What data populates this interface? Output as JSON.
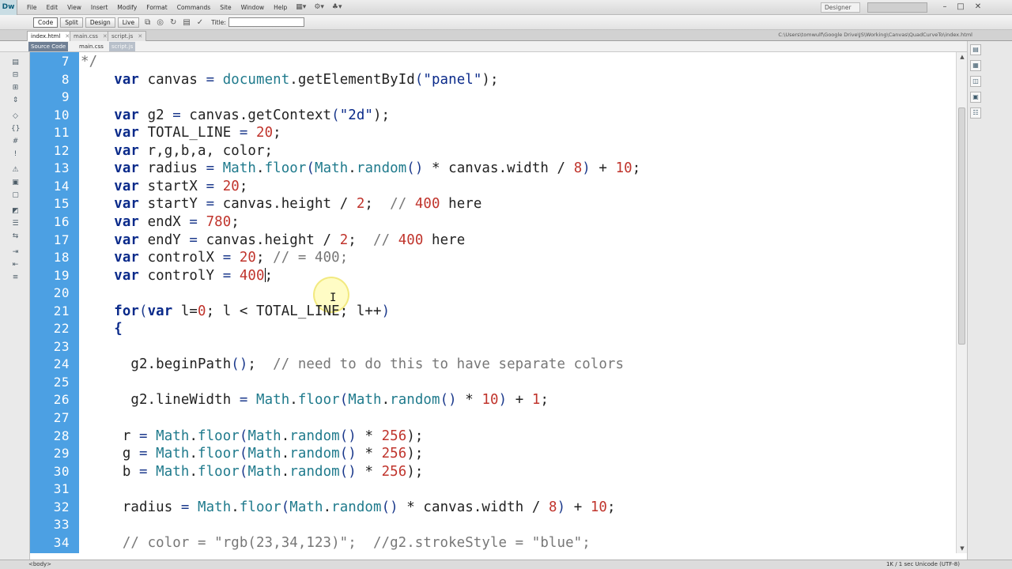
{
  "app": {
    "logo": "Dw"
  },
  "menu": [
    "File",
    "Edit",
    "View",
    "Insert",
    "Modify",
    "Format",
    "Commands",
    "Site",
    "Window",
    "Help"
  ],
  "workspace": "Designer",
  "toolbar": {
    "code": "Code",
    "split": "Split",
    "design": "Design",
    "live": "Live",
    "title_label": "Title:",
    "title_value": ""
  },
  "tabs": [
    {
      "label": "index.html",
      "active": true
    },
    {
      "label": "main.css",
      "active": false
    },
    {
      "label": "script.js",
      "active": false
    }
  ],
  "file_path": "C:\\Users\\tomwulf\\Google Drive\\JS\\Working\\Canvas\\QuadCurveTo\\index.html",
  "related": [
    "Source Code",
    "main.css",
    "script.js"
  ],
  "code": {
    "lines": [
      {
        "n": "7",
        "t": [
          [
            "*/",
            "cm"
          ]
        ]
      },
      {
        "n": "8",
        "t": [
          [
            "    ",
            ""
          ],
          [
            "var",
            "kw"
          ],
          [
            " canvas ",
            ""
          ],
          [
            "=",
            "op"
          ],
          [
            " ",
            ""
          ],
          [
            "document",
            "fn"
          ],
          [
            ".getElementById",
            ""
          ],
          [
            "(",
            "op"
          ],
          [
            "\"panel\"",
            "str"
          ],
          [
            ");",
            ""
          ]
        ]
      },
      {
        "n": "9",
        "t": []
      },
      {
        "n": "10",
        "t": [
          [
            "    ",
            ""
          ],
          [
            "var",
            "kw"
          ],
          [
            " g2 ",
            ""
          ],
          [
            "=",
            "op"
          ],
          [
            " canvas.getContext",
            ""
          ],
          [
            "(",
            "op"
          ],
          [
            "\"2d\"",
            "str"
          ],
          [
            ");",
            ""
          ]
        ]
      },
      {
        "n": "11",
        "t": [
          [
            "    ",
            ""
          ],
          [
            "var",
            "kw"
          ],
          [
            " TOTAL_LINE ",
            ""
          ],
          [
            "=",
            "op"
          ],
          [
            " ",
            ""
          ],
          [
            "20",
            "num"
          ],
          [
            ";",
            ""
          ]
        ]
      },
      {
        "n": "12",
        "t": [
          [
            "    ",
            ""
          ],
          [
            "var",
            "kw"
          ],
          [
            " r,g,b,a, color;",
            ""
          ]
        ]
      },
      {
        "n": "13",
        "t": [
          [
            "    ",
            ""
          ],
          [
            "var",
            "kw"
          ],
          [
            " radius ",
            ""
          ],
          [
            "=",
            "op"
          ],
          [
            " ",
            ""
          ],
          [
            "Math",
            "fn"
          ],
          [
            ".",
            ""
          ],
          [
            "floor",
            "fn"
          ],
          [
            "(",
            "op"
          ],
          [
            "Math",
            "fn"
          ],
          [
            ".",
            ""
          ],
          [
            "random",
            "fn"
          ],
          [
            "()",
            "op"
          ],
          [
            " * canvas.width / ",
            ""
          ],
          [
            "8",
            "num"
          ],
          [
            ")",
            "op"
          ],
          [
            " + ",
            ""
          ],
          [
            "10",
            "num"
          ],
          [
            ";",
            ""
          ]
        ]
      },
      {
        "n": "14",
        "t": [
          [
            "    ",
            ""
          ],
          [
            "var",
            "kw"
          ],
          [
            " startX ",
            ""
          ],
          [
            "=",
            "op"
          ],
          [
            " ",
            ""
          ],
          [
            "20",
            "num"
          ],
          [
            ";",
            ""
          ]
        ]
      },
      {
        "n": "15",
        "t": [
          [
            "    ",
            ""
          ],
          [
            "var",
            "kw"
          ],
          [
            " startY ",
            ""
          ],
          [
            "=",
            "op"
          ],
          [
            " canvas.height / ",
            ""
          ],
          [
            "2",
            "num"
          ],
          [
            ";  ",
            ""
          ],
          [
            "// ",
            "cm"
          ],
          [
            "400",
            "num"
          ],
          [
            " here",
            ""
          ]
        ]
      },
      {
        "n": "16",
        "t": [
          [
            "    ",
            ""
          ],
          [
            "var",
            "kw"
          ],
          [
            " endX ",
            ""
          ],
          [
            "=",
            "op"
          ],
          [
            " ",
            ""
          ],
          [
            "780",
            "num"
          ],
          [
            ";",
            ""
          ]
        ]
      },
      {
        "n": "17",
        "t": [
          [
            "    ",
            ""
          ],
          [
            "var",
            "kw"
          ],
          [
            " endY ",
            ""
          ],
          [
            "=",
            "op"
          ],
          [
            " canvas.height / ",
            ""
          ],
          [
            "2",
            "num"
          ],
          [
            ";  ",
            ""
          ],
          [
            "// ",
            "cm"
          ],
          [
            "400",
            "num"
          ],
          [
            " here",
            ""
          ]
        ]
      },
      {
        "n": "18",
        "t": [
          [
            "    ",
            ""
          ],
          [
            "var",
            "kw"
          ],
          [
            " controlX ",
            ""
          ],
          [
            "=",
            "op"
          ],
          [
            " ",
            ""
          ],
          [
            "20",
            "num"
          ],
          [
            ";",
            ""
          ],
          [
            " // = 400;",
            "cm"
          ]
        ]
      },
      {
        "n": "19",
        "t": [
          [
            "    ",
            ""
          ],
          [
            "var",
            "kw"
          ],
          [
            " controlY ",
            ""
          ],
          [
            "=",
            "op"
          ],
          [
            " ",
            ""
          ],
          [
            "400",
            "num"
          ],
          [
            "|caret",
            ""
          ],
          [
            ";",
            ""
          ]
        ]
      },
      {
        "n": "20",
        "t": []
      },
      {
        "n": "21",
        "t": [
          [
            "    ",
            ""
          ],
          [
            "for",
            "kw"
          ],
          [
            "(",
            "op"
          ],
          [
            "var",
            "kw"
          ],
          [
            " l=",
            ""
          ],
          [
            "0",
            "num"
          ],
          [
            "; l < TOTAL_LINE; l++",
            ""
          ],
          [
            ")",
            "op"
          ]
        ]
      },
      {
        "n": "22",
        "t": [
          [
            "    ",
            ""
          ],
          [
            "{",
            "kw"
          ]
        ]
      },
      {
        "n": "23",
        "t": []
      },
      {
        "n": "24",
        "t": [
          [
            "      g2.beginPath",
            ""
          ],
          [
            "()",
            "op"
          ],
          [
            ";  ",
            ""
          ],
          [
            "// need to do this to have separate colors",
            "cm"
          ]
        ]
      },
      {
        "n": "25",
        "t": []
      },
      {
        "n": "26",
        "t": [
          [
            "      g2.lineWidth ",
            ""
          ],
          [
            "=",
            "op"
          ],
          [
            " ",
            ""
          ],
          [
            "Math",
            "fn"
          ],
          [
            ".",
            ""
          ],
          [
            "floor",
            "fn"
          ],
          [
            "(",
            "op"
          ],
          [
            "Math",
            "fn"
          ],
          [
            ".",
            ""
          ],
          [
            "random",
            "fn"
          ],
          [
            "()",
            "op"
          ],
          [
            " * ",
            ""
          ],
          [
            "10",
            "num"
          ],
          [
            ")",
            "op"
          ],
          [
            " + ",
            ""
          ],
          [
            "1",
            "num"
          ],
          [
            ";",
            ""
          ]
        ]
      },
      {
        "n": "27",
        "t": []
      },
      {
        "n": "28",
        "t": [
          [
            "     r ",
            ""
          ],
          [
            "=",
            "op"
          ],
          [
            " ",
            ""
          ],
          [
            "Math",
            "fn"
          ],
          [
            ".",
            ""
          ],
          [
            "floor",
            "fn"
          ],
          [
            "(",
            "op"
          ],
          [
            "Math",
            "fn"
          ],
          [
            ".",
            ""
          ],
          [
            "random",
            "fn"
          ],
          [
            "()",
            "op"
          ],
          [
            " * ",
            ""
          ],
          [
            "256",
            "num"
          ],
          [
            ");",
            ""
          ]
        ]
      },
      {
        "n": "29",
        "t": [
          [
            "     g ",
            ""
          ],
          [
            "=",
            "op"
          ],
          [
            " ",
            ""
          ],
          [
            "Math",
            "fn"
          ],
          [
            ".",
            ""
          ],
          [
            "floor",
            "fn"
          ],
          [
            "(",
            "op"
          ],
          [
            "Math",
            "fn"
          ],
          [
            ".",
            ""
          ],
          [
            "random",
            "fn"
          ],
          [
            "()",
            "op"
          ],
          [
            " * ",
            ""
          ],
          [
            "256",
            "num"
          ],
          [
            ");",
            ""
          ]
        ]
      },
      {
        "n": "30",
        "t": [
          [
            "     b ",
            ""
          ],
          [
            "=",
            "op"
          ],
          [
            " ",
            ""
          ],
          [
            "Math",
            "fn"
          ],
          [
            ".",
            ""
          ],
          [
            "floor",
            "fn"
          ],
          [
            "(",
            "op"
          ],
          [
            "Math",
            "fn"
          ],
          [
            ".",
            ""
          ],
          [
            "random",
            "fn"
          ],
          [
            "()",
            "op"
          ],
          [
            " * ",
            ""
          ],
          [
            "256",
            "num"
          ],
          [
            ");",
            ""
          ]
        ]
      },
      {
        "n": "31",
        "t": []
      },
      {
        "n": "32",
        "t": [
          [
            "     radius ",
            ""
          ],
          [
            "=",
            "op"
          ],
          [
            " ",
            ""
          ],
          [
            "Math",
            "fn"
          ],
          [
            ".",
            ""
          ],
          [
            "floor",
            "fn"
          ],
          [
            "(",
            "op"
          ],
          [
            "Math",
            "fn"
          ],
          [
            ".",
            ""
          ],
          [
            "random",
            "fn"
          ],
          [
            "()",
            "op"
          ],
          [
            " * canvas.width / ",
            ""
          ],
          [
            "8",
            "num"
          ],
          [
            ")",
            "op"
          ],
          [
            " + ",
            ""
          ],
          [
            "10",
            "num"
          ],
          [
            ";",
            ""
          ]
        ]
      },
      {
        "n": "33",
        "t": []
      },
      {
        "n": "34",
        "t": [
          [
            "     ",
            ""
          ],
          [
            "// color = \"rgb(23,34,123)\";  //g2.strokeStyle = \"blue\";",
            "cm"
          ]
        ]
      }
    ]
  },
  "status": {
    "tag": "<body>",
    "info": "1K / 1 sec  Unicode (UTF-8)"
  },
  "colors": {
    "gutter": "#4ca0e3",
    "keyword": "#0a2a8a",
    "number": "#c0342c",
    "function": "#1f7a8c"
  }
}
